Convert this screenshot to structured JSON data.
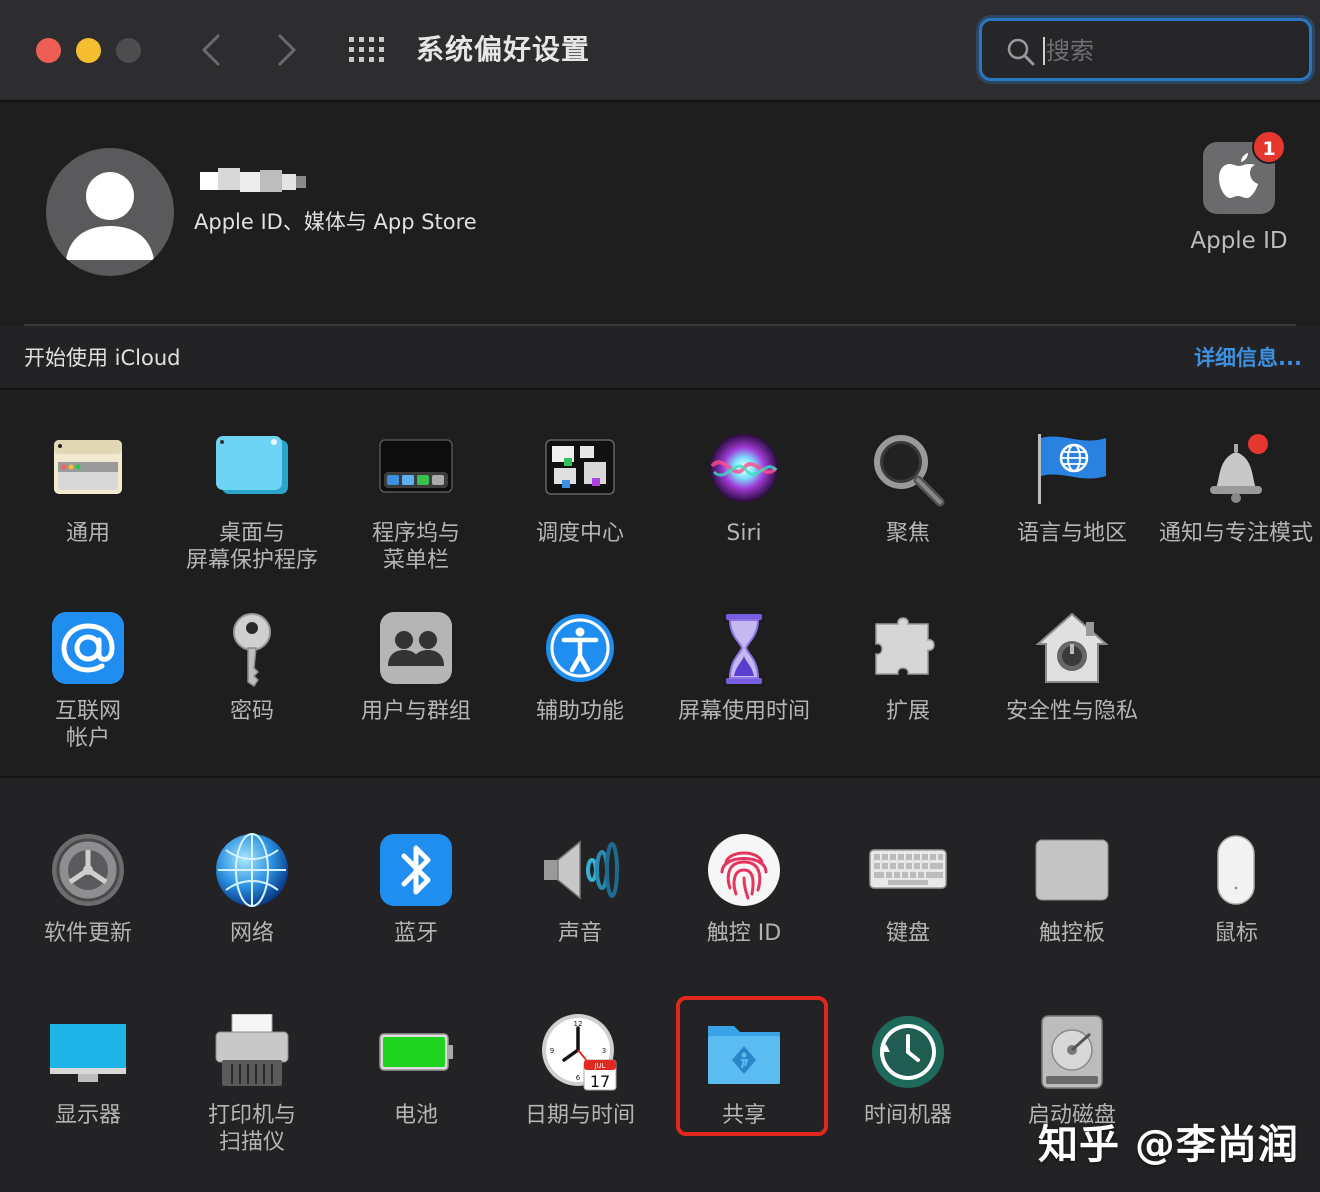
{
  "window": {
    "title": "系统偏好设置",
    "search_placeholder": "搜索"
  },
  "account": {
    "subtitle": "Apple ID、媒体与 App Store",
    "appleid_label": "Apple ID",
    "badge_count": "1"
  },
  "icloud": {
    "prompt": "开始使用 iCloud",
    "details_link": "详细信息..."
  },
  "panes": {
    "row1": [
      "通用",
      "桌面与\n屏幕保护程序",
      "程序坞与\n菜单栏",
      "调度中心",
      "Siri",
      "聚焦",
      "语言与地区",
      "通知与专注模式"
    ],
    "row2": [
      "互联网\n帐户",
      "密码",
      "用户与群组",
      "辅助功能",
      "屏幕使用时间",
      "扩展",
      "安全性与隐私"
    ],
    "row3": [
      "软件更新",
      "网络",
      "蓝牙",
      "声音",
      "触控 ID",
      "键盘",
      "触控板",
      "鼠标"
    ],
    "row4": [
      "显示器",
      "打印机与\n扫描仪",
      "电池",
      "日期与时间",
      "共享",
      "时间机器",
      "启动磁盘"
    ]
  },
  "calendar_icon": {
    "month": "JUL",
    "day": "17"
  },
  "watermark": "知乎 @李尚润",
  "colors": {
    "accent": "#2b76c0",
    "link": "#3d8fe0",
    "highlight": "#e0281f",
    "badge": "#e5372d"
  }
}
